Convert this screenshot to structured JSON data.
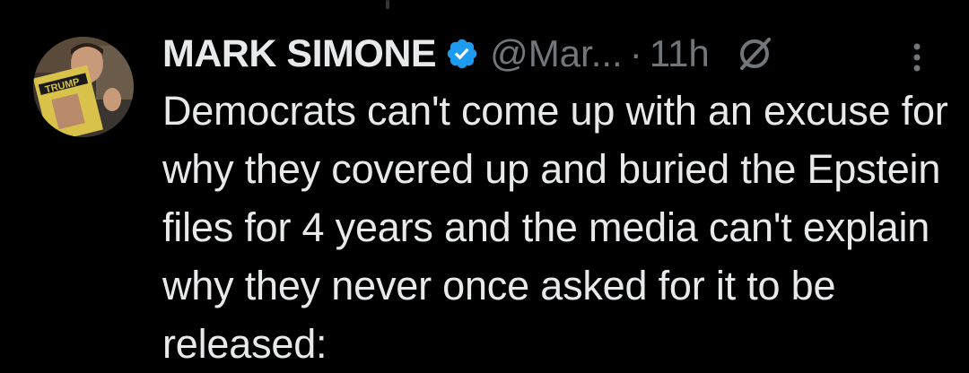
{
  "tweet": {
    "display_name": "MARK SIMONE",
    "handle": "@Mar...",
    "separator": "·",
    "time": "11h",
    "text": "Democrats can't come up with an excuse for why they covered up and buried the Epstein files for 4 years and the media can't explain why they never once asked for it to be released:",
    "avatar_book_text": "TRUMP"
  },
  "icons": {
    "verified": "verified-badge-icon",
    "grok": "grok-icon",
    "more": "more-options-icon"
  },
  "colors": {
    "background": "#000000",
    "text": "#e7e9ea",
    "secondary": "#71767b",
    "verified": "#1d9bf0"
  }
}
